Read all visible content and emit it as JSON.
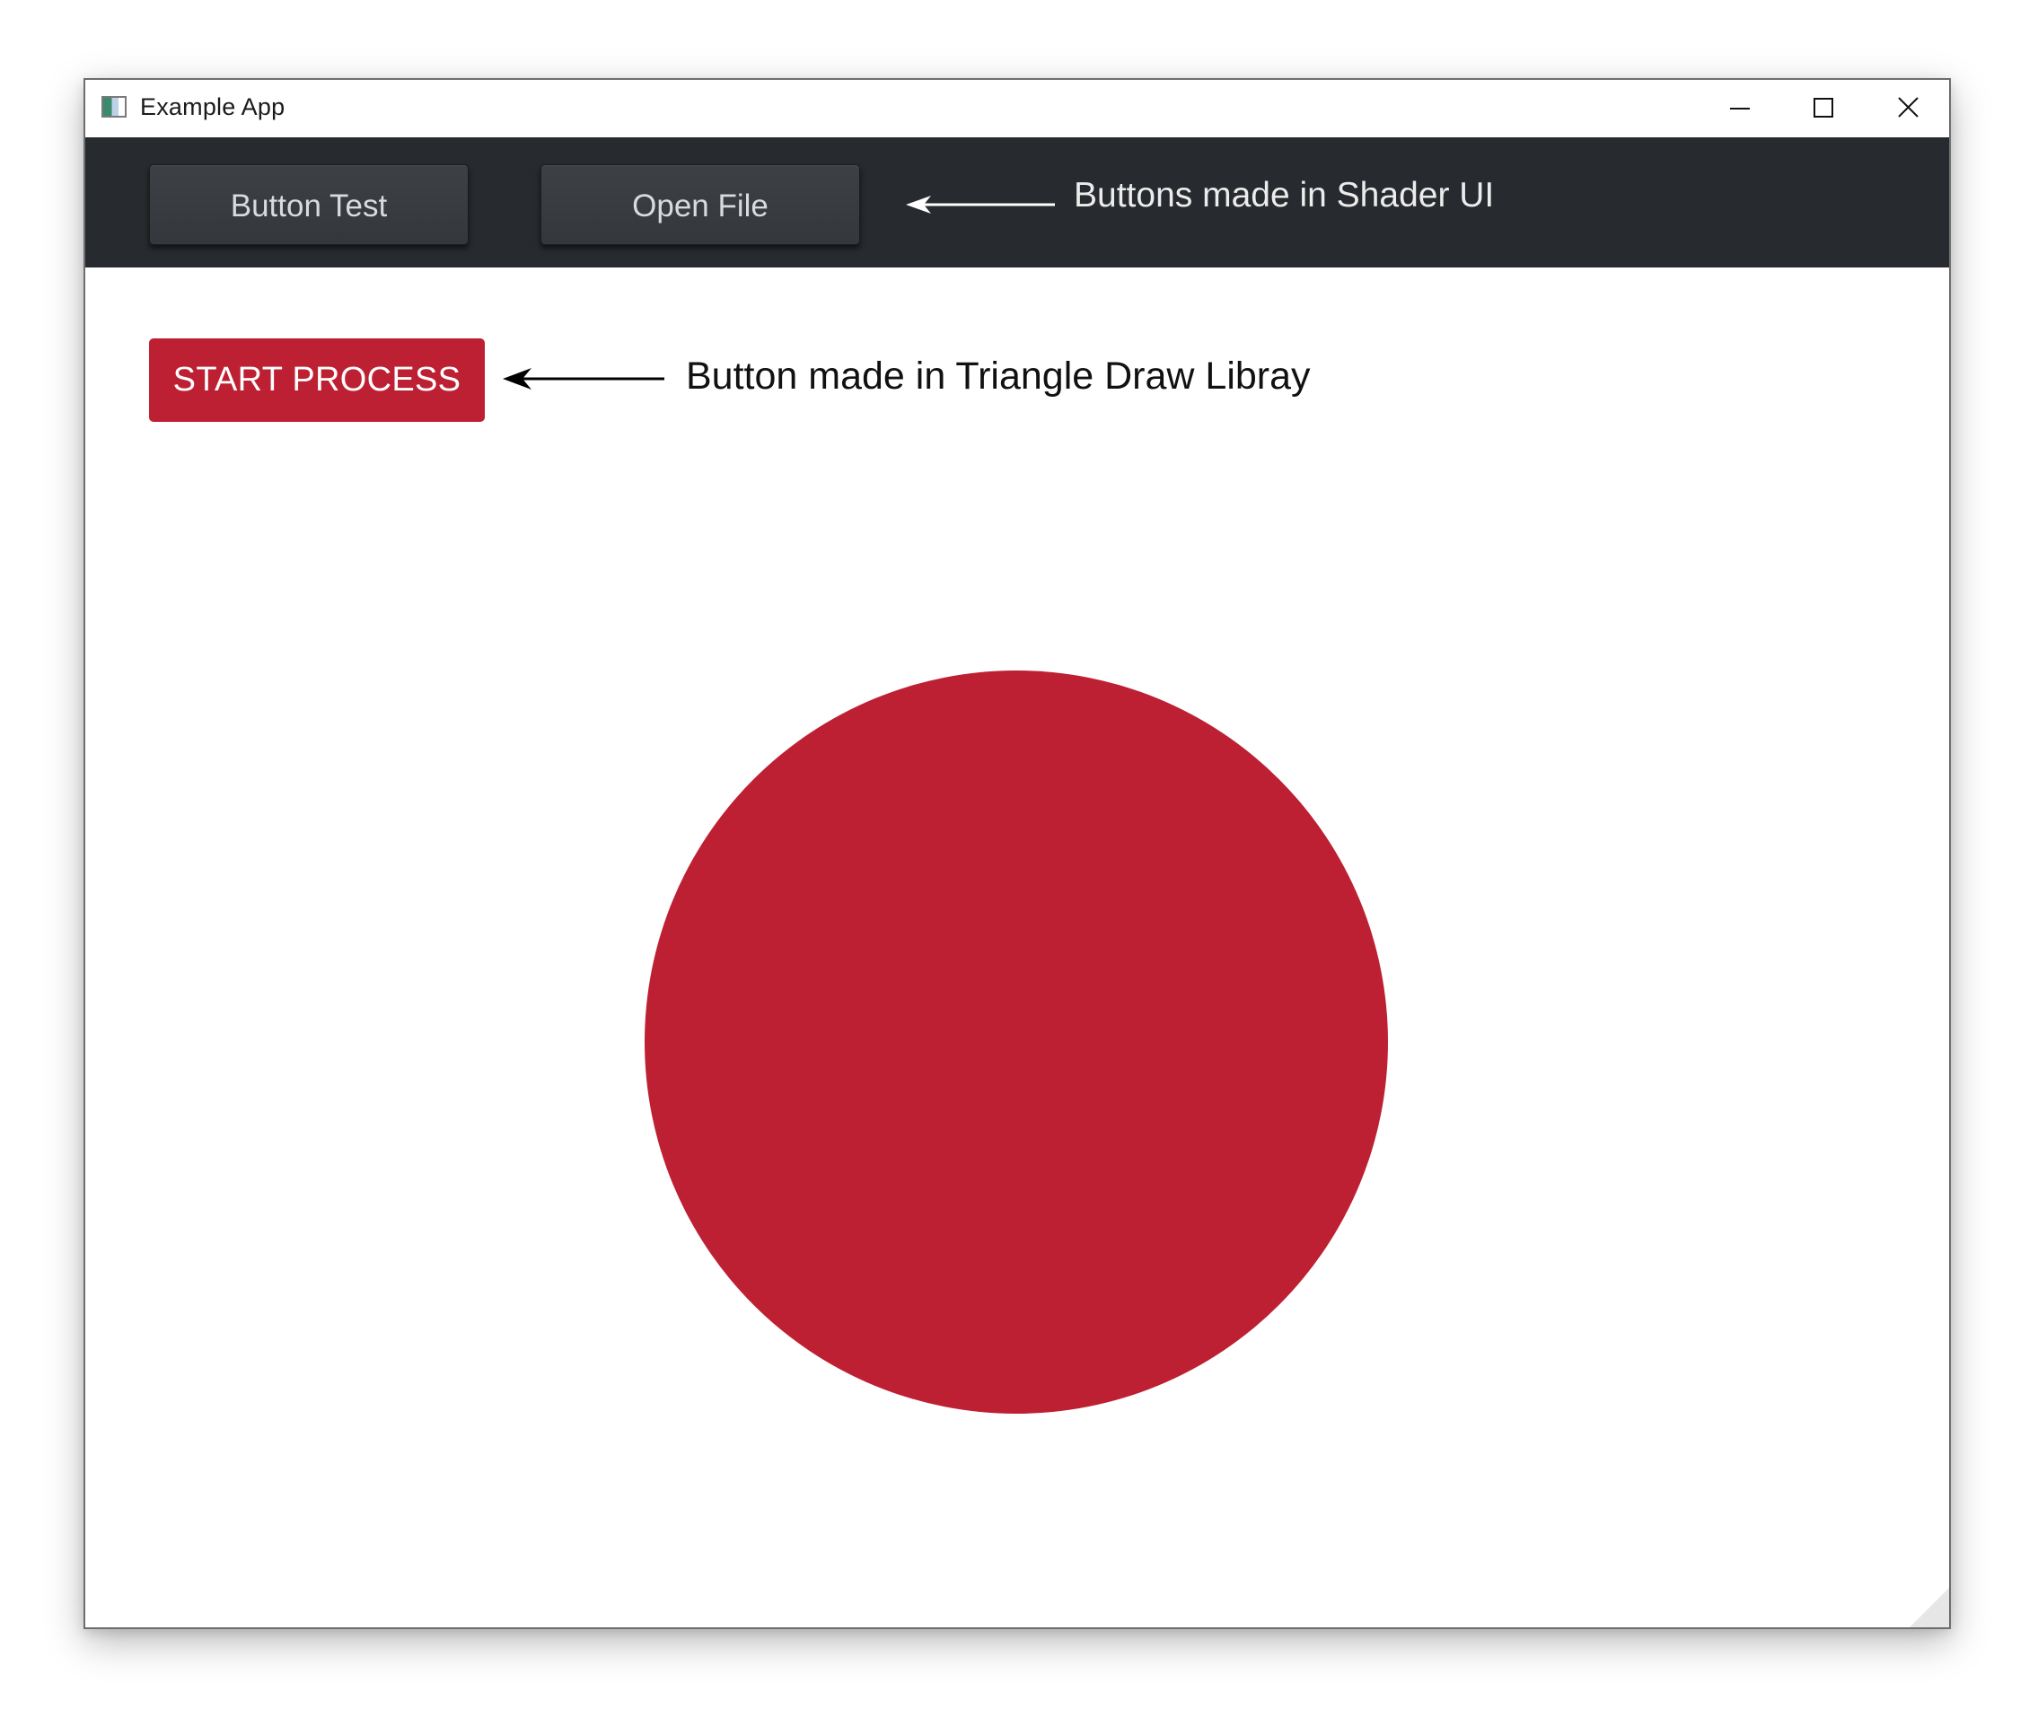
{
  "window": {
    "title": "Example App",
    "icon": "app-window-icon",
    "controls": {
      "minimize_icon": "minimize-icon",
      "maximize_icon": "maximize-icon",
      "close_icon": "close-icon"
    }
  },
  "toolbar": {
    "buttons": [
      {
        "label": "Button Test"
      },
      {
        "label": "Open File"
      }
    ],
    "annotation": "Buttons made in Shader UI",
    "annotation_icon": "arrow-left-icon"
  },
  "content": {
    "start_button": {
      "label": "START PROCESS"
    },
    "annotation": "Button made in Triangle Draw Libray",
    "annotation_icon": "arrow-left-icon",
    "shape": "circle"
  },
  "colors": {
    "toolbar_bg": "#272a2e",
    "shader_button_bg": "#3a3d42",
    "accent_red": "#be2033",
    "window_bg": "#ffffff"
  }
}
